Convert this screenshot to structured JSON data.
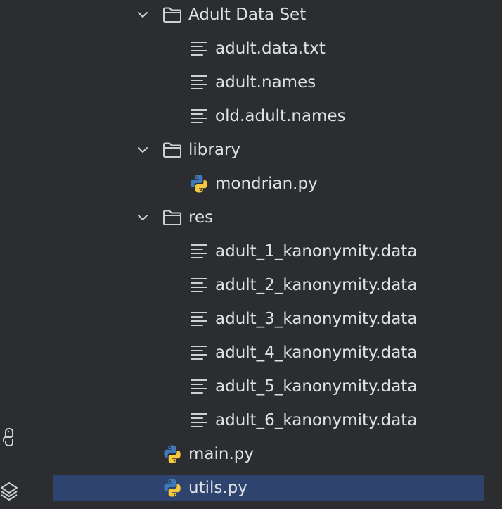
{
  "tree": {
    "rows": [
      {
        "id": "adult-data-set",
        "label": "Adult Data Set",
        "type": "folder",
        "expanded": true,
        "depth": 0,
        "icon": "folder-icon"
      },
      {
        "id": "adult-data-txt",
        "label": "adult.data.txt",
        "type": "text-file",
        "depth": 1,
        "icon": "text-file-icon"
      },
      {
        "id": "adult-names",
        "label": "adult.names",
        "type": "text-file",
        "depth": 1,
        "icon": "text-file-icon"
      },
      {
        "id": "old-adult-names",
        "label": "old.adult.names",
        "type": "text-file",
        "depth": 1,
        "icon": "text-file-icon"
      },
      {
        "id": "library",
        "label": "library",
        "type": "folder",
        "expanded": true,
        "depth": 0,
        "icon": "folder-icon"
      },
      {
        "id": "mondrian-py",
        "label": "mondrian.py",
        "type": "python-file",
        "depth": 1,
        "icon": "python-file-icon"
      },
      {
        "id": "res",
        "label": "res",
        "type": "folder",
        "expanded": true,
        "depth": 0,
        "icon": "folder-icon"
      },
      {
        "id": "adult-1",
        "label": "adult_1_kanonymity.data",
        "type": "text-file",
        "depth": 1,
        "icon": "text-file-icon"
      },
      {
        "id": "adult-2",
        "label": "adult_2_kanonymity.data",
        "type": "text-file",
        "depth": 1,
        "icon": "text-file-icon"
      },
      {
        "id": "adult-3",
        "label": "adult_3_kanonymity.data",
        "type": "text-file",
        "depth": 1,
        "icon": "text-file-icon"
      },
      {
        "id": "adult-4",
        "label": "adult_4_kanonymity.data",
        "type": "text-file",
        "depth": 1,
        "icon": "text-file-icon"
      },
      {
        "id": "adult-5",
        "label": "adult_5_kanonymity.data",
        "type": "text-file",
        "depth": 1,
        "icon": "text-file-icon"
      },
      {
        "id": "adult-6",
        "label": "adult_6_kanonymity.data",
        "type": "text-file",
        "depth": 1,
        "icon": "text-file-icon"
      },
      {
        "id": "main-py",
        "label": "main.py",
        "type": "python-file",
        "depth": 0,
        "icon": "python-file-icon"
      },
      {
        "id": "utils-py",
        "label": "utils.py",
        "type": "python-file",
        "depth": 0,
        "icon": "python-file-icon",
        "selected": true
      }
    ]
  },
  "gutter": {
    "icons": [
      "python-console-icon",
      "layers-icon"
    ]
  },
  "colors": {
    "background": "#2b2d30",
    "selection": "#2e436e",
    "text": "#dfe1e5",
    "icon_gray": "#ced0d6",
    "python_blue": "#3e7ab8",
    "python_yellow": "#f5c93e"
  }
}
